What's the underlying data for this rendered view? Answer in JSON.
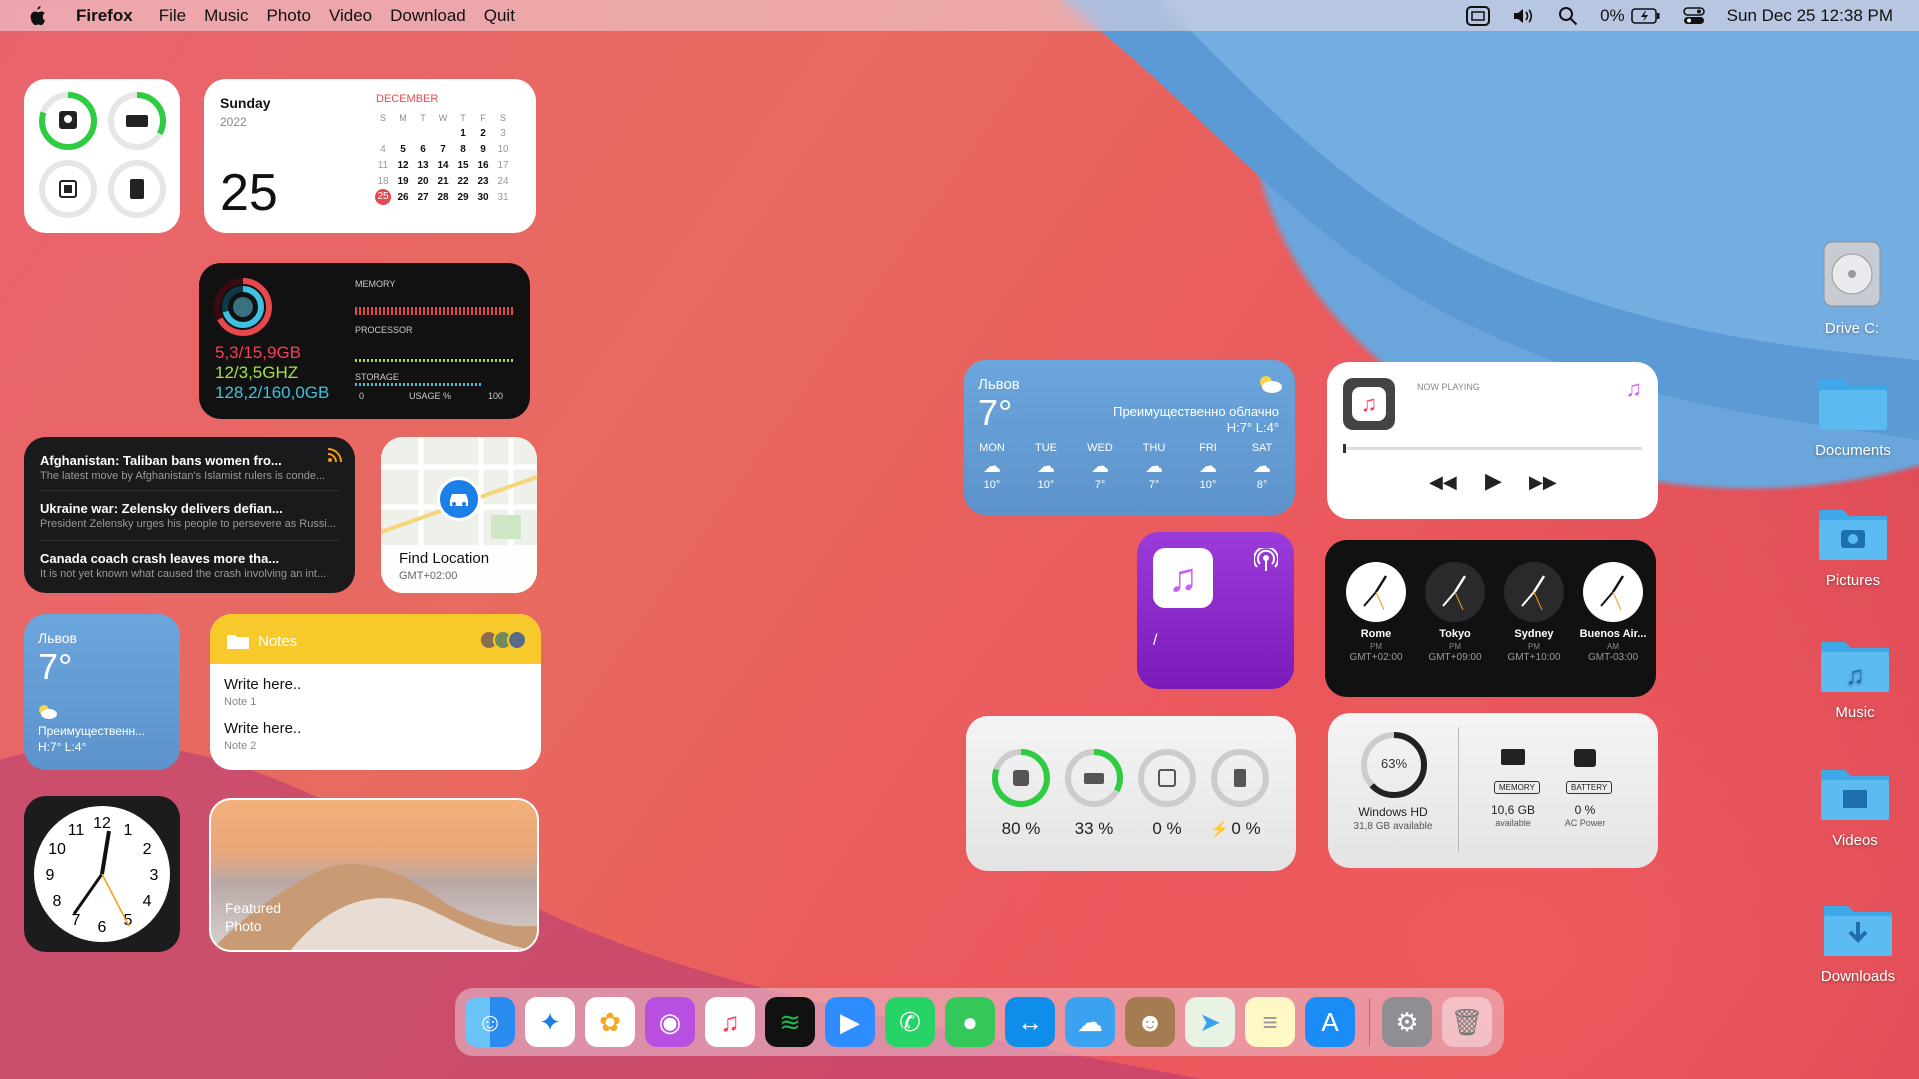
{
  "menubar": {
    "app": "Firefox",
    "items": [
      "File",
      "Music",
      "Photo",
      "Video",
      "Download",
      "Quit"
    ],
    "battery": "0%",
    "datetime": "Sun Dec 25  12:38 PM"
  },
  "colors": {
    "accent_green": "#2ecc40",
    "accent_red": "#e5484d",
    "accent_blue": "#0a84ff"
  },
  "calendar": {
    "weekday": "Sunday",
    "year": "2022",
    "day": "25",
    "month": "DECEMBER",
    "headers": [
      "S",
      "M",
      "T",
      "W",
      "T",
      "F",
      "S"
    ],
    "rows": [
      [
        "",
        "",
        "",
        "",
        "1",
        "2",
        "3"
      ],
      [
        "4",
        "5",
        "6",
        "7",
        "8",
        "9",
        "10"
      ],
      [
        "11",
        "12",
        "13",
        "14",
        "15",
        "16",
        "17"
      ],
      [
        "18",
        "19",
        "20",
        "21",
        "22",
        "23",
        "24"
      ],
      [
        "25",
        "26",
        "27",
        "28",
        "29",
        "30",
        "31"
      ]
    ]
  },
  "stats": {
    "memory": "5,3/15,9GB",
    "processor": "12/3,5GHZ",
    "storage": "128,2/160,0GB",
    "memory_label": "MEMORY",
    "processor_label": "PROCESSOR",
    "storage_label": "STORAGE",
    "axis_min": "0",
    "axis_label": "USAGE %",
    "axis_max": "100"
  },
  "news": [
    {
      "title": "Afghanistan: Taliban bans women fro...",
      "desc": "The latest move by Afghanistan's Islamist rulers is conde..."
    },
    {
      "title": "Ukraine war: Zelensky delivers defian...",
      "desc": "President Zelensky urges his people to persevere as Russi..."
    },
    {
      "title": "Canada coach crash leaves more tha...",
      "desc": "It is not yet known what caused the crash involving an int..."
    }
  ],
  "find": {
    "title": "Find Location",
    "tz": "GMT+02:00"
  },
  "weather_small": {
    "city": "Львов",
    "temp": "7°",
    "cond": "Преимущественн...",
    "hl": "H:7° L:4°"
  },
  "notes": {
    "header": "Notes",
    "items": [
      {
        "title": "Write here..",
        "sub": "Note 1"
      },
      {
        "title": "Write here..",
        "sub": "Note 2"
      }
    ]
  },
  "photo": {
    "label1": "Featured",
    "label2": "Photo"
  },
  "weather_big": {
    "city": "Львов",
    "temp": "7°",
    "cond": "Преимущественно облачно",
    "hl": "H:7°  L:4°",
    "days": [
      {
        "d": "MON",
        "t": "10°"
      },
      {
        "d": "TUE",
        "t": "10°"
      },
      {
        "d": "WED",
        "t": "7°"
      },
      {
        "d": "THU",
        "t": "7°"
      },
      {
        "d": "FRI",
        "t": "10°"
      },
      {
        "d": "SAT",
        "t": "8°"
      }
    ]
  },
  "nowplaying": {
    "label": "NOW PLAYING"
  },
  "podcast": {
    "text": "/"
  },
  "clocks": [
    {
      "city": "Rome",
      "ampm": "PM",
      "tz": "GMT+02:00"
    },
    {
      "city": "Tokyo",
      "ampm": "PM",
      "tz": "GMT+09:00"
    },
    {
      "city": "Sydney",
      "ampm": "PM",
      "tz": "GMT+10:00"
    },
    {
      "city": "Buenos Air...",
      "ampm": "AM",
      "tz": "GMT-03:00"
    }
  ],
  "usage": {
    "v1": "80 %",
    "v2": "33 %",
    "v3": "0 %",
    "v4": "0 %"
  },
  "disk": {
    "pct": "63%",
    "name": "Windows HD",
    "avail": "31,8 GB available",
    "mem_lbl": "MEMORY",
    "mem_val": "10,6 GB",
    "mem_sub": "available",
    "bat_lbl": "BATTERY",
    "bat_val": "0 %",
    "bat_sub": "AC Power"
  },
  "desktop": {
    "drive": "Drive C:",
    "documents": "Documents",
    "pictures": "Pictures",
    "music": "Music",
    "videos": "Videos",
    "downloads": "Downloads"
  },
  "analog_numbers": [
    "12",
    "1",
    "2",
    "3",
    "4",
    "5",
    "6",
    "7",
    "8",
    "9",
    "10",
    "11"
  ]
}
